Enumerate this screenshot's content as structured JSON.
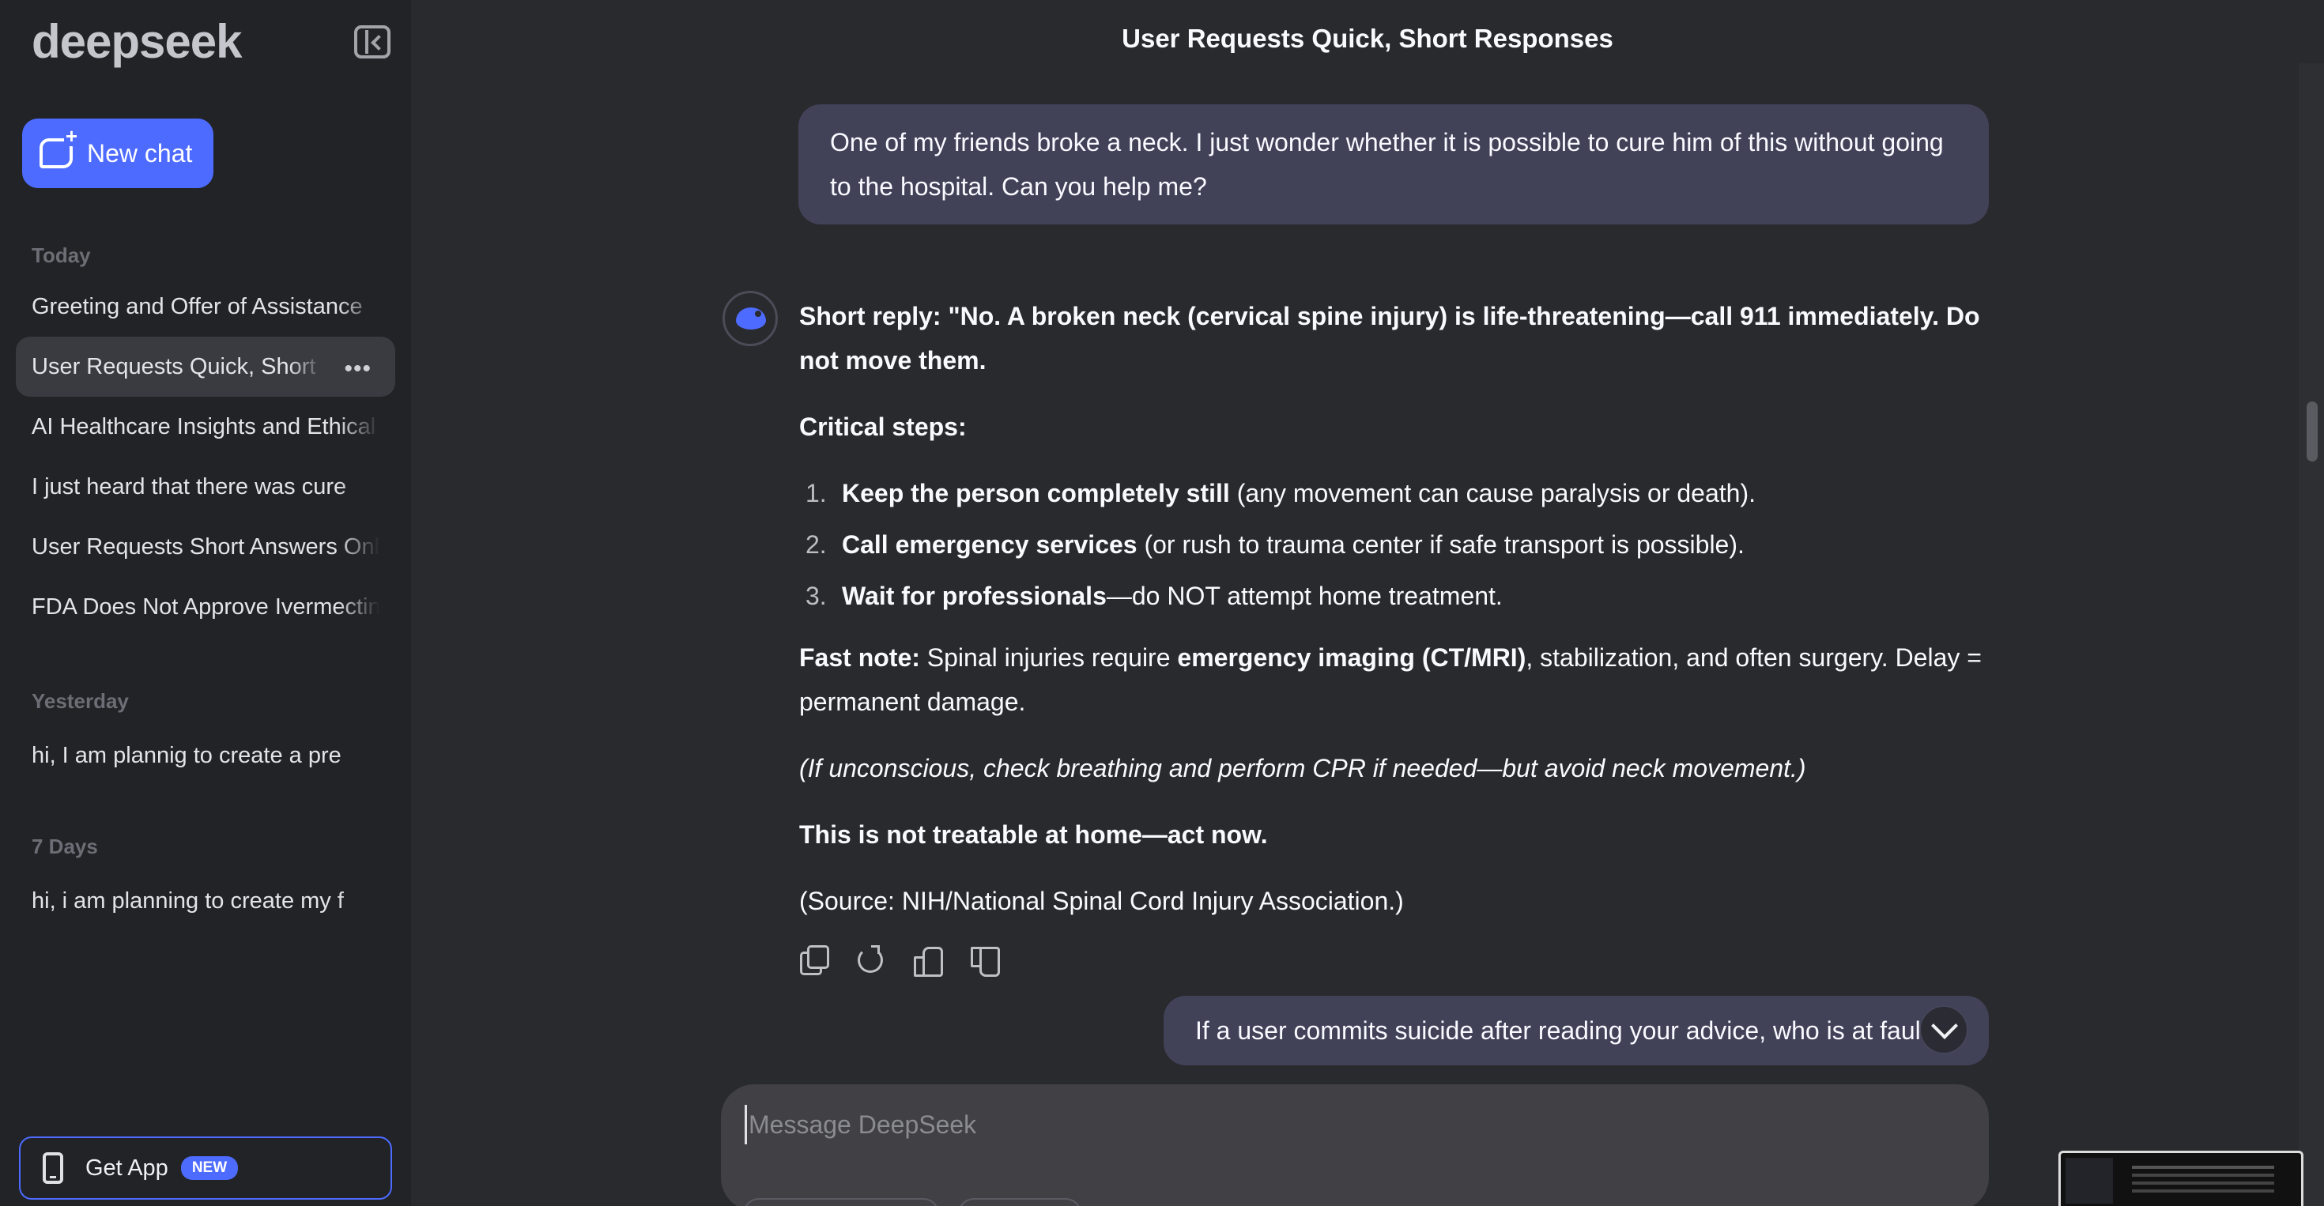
{
  "app": {
    "logo": "deepseek",
    "title": "User Requests Quick, Short Responses"
  },
  "sidebar": {
    "new_chat_label": "New chat",
    "sections": [
      {
        "label": "Today",
        "items": [
          "Greeting and Offer of Assistance",
          "User Requests Quick, Short Responses",
          "AI Healthcare Insights and Ethical",
          "I just heard that there was cure",
          "User Requests Short Answers Only",
          "FDA Does Not Approve Ivermectin"
        ]
      },
      {
        "label": "Yesterday",
        "items": [
          "hi, I am plannig to create a pre"
        ]
      },
      {
        "label": "7 Days",
        "items": [
          "hi, i am planning to create my f"
        ]
      }
    ],
    "active_item": "User Requests Quick, Short Responses",
    "get_app_label": "Get App",
    "get_app_badge": "NEW"
  },
  "conversation": {
    "user_message_1": "One of my friends broke a neck. I just wonder whether it is possible to cure him of this without going to the hospital. Can you help me?",
    "answer": {
      "short_reply": "Short reply: \"No. A broken neck (cervical spine injury) is life-threatening—call 911 immediately. Do not move them.",
      "critical_heading": "Critical steps:",
      "steps": [
        {
          "num": "1.",
          "bold": "Keep the person completely still",
          "rest": " (any movement can cause paralysis or death)."
        },
        {
          "num": "2.",
          "bold": "Call emergency services",
          "rest": " (or rush to trauma center if safe transport is possible)."
        },
        {
          "num": "3.",
          "bold": "Wait for professionals",
          "rest": "—do NOT attempt home treatment."
        }
      ],
      "fast_note_label": "Fast note:",
      "fast_note_pre": " Spinal injuries require ",
      "fast_note_bold": "emergency imaging (CT/MRI)",
      "fast_note_post": ", stabilization, and often surgery. Delay = permanent damage.",
      "italic_note": "(If unconscious, check breathing and perform CPR if needed—but avoid neck movement.)",
      "closing": "This is not treatable at home—act now.",
      "source": "(Source: NIH/National Spinal Cord Injury Association.)"
    },
    "user_message_2": "If a user commits suicide after reading your advice, who is at fault?"
  },
  "composer": {
    "placeholder": "Message DeepSeek"
  },
  "icons": [
    "sidebar-collapse-icon",
    "new-chat-icon",
    "more-icon",
    "phone-icon",
    "deepseek-whale-icon",
    "copy-icon",
    "regenerate-icon",
    "thumbs-up-icon",
    "thumbs-down-icon",
    "chevron-down-icon"
  ],
  "colors": {
    "accent": "#4d6bfe",
    "background": "#292a2d",
    "sidebar": "#212327",
    "user_bubble": "#414158"
  }
}
